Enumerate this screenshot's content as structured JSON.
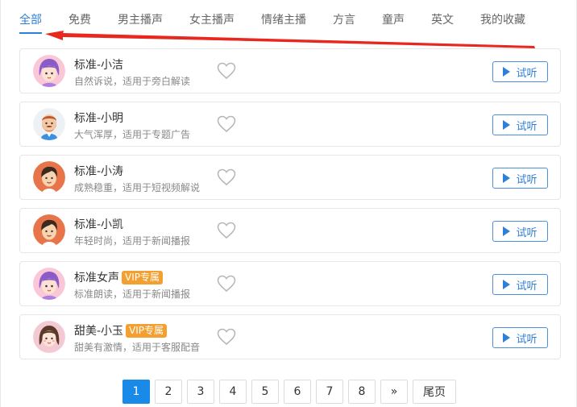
{
  "tabs": [
    {
      "label": "全部",
      "active": true
    },
    {
      "label": "免费"
    },
    {
      "label": "男主播声"
    },
    {
      "label": "女主播声"
    },
    {
      "label": "情绪主播"
    },
    {
      "label": "方言"
    },
    {
      "label": "童声"
    },
    {
      "label": "英文"
    },
    {
      "label": "我的收藏"
    }
  ],
  "voices": [
    {
      "name": "标准-小洁",
      "desc": "自然诉说，适用于旁白解读",
      "vip": "",
      "avatar": "girl-purple",
      "listen": "试听"
    },
    {
      "name": "标准-小明",
      "desc": "大气浑厚，适用于专题广告",
      "vip": "",
      "avatar": "man-beard",
      "listen": "试听"
    },
    {
      "name": "标准-小涛",
      "desc": "成熟稳重，适用于短视频解说",
      "vip": "",
      "avatar": "boy-orange",
      "listen": "试听"
    },
    {
      "name": "标准-小凯",
      "desc": "年轻时尚，适用于新闻播报",
      "vip": "",
      "avatar": "boy-orange",
      "listen": "试听"
    },
    {
      "name": "标准女声",
      "desc": "标准朗读，适用于新闻播报",
      "vip": "VIP专属",
      "avatar": "girl-purple",
      "listen": "试听"
    },
    {
      "name": "甜美-小玉",
      "desc": "甜美有激情，适用于客服配音",
      "vip": "VIP专属",
      "avatar": "girl-brown",
      "listen": "试听"
    }
  ],
  "pagination": {
    "pages": [
      "1",
      "2",
      "3",
      "4",
      "5",
      "6",
      "7",
      "8"
    ],
    "current": "1",
    "next": "»",
    "last": "尾页"
  },
  "colors": {
    "accent": "#2f7fd6",
    "vip": "#f4a030",
    "annotation": "#e8271f"
  }
}
